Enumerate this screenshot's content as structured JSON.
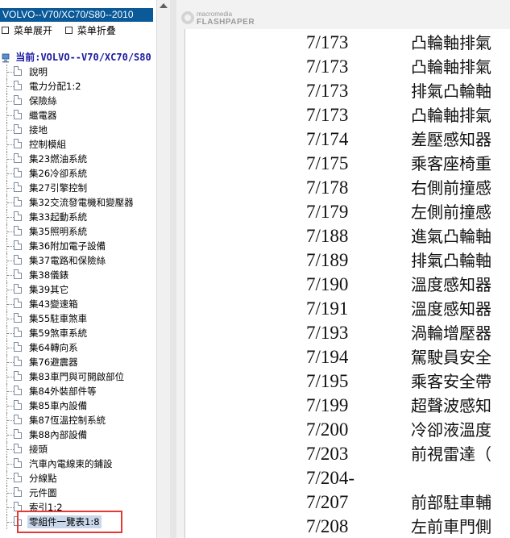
{
  "left_panel": {
    "title": "VOLVO--V70/XC70/S80--2010",
    "menu_expand": "菜单展开",
    "menu_collapse": "菜单折叠",
    "tree_root": "当前:VOLVO--V70/XC70/S80",
    "items": [
      {
        "label": "說明"
      },
      {
        "label": "電力分配1:2"
      },
      {
        "label": "保險絲"
      },
      {
        "label": "繼電器"
      },
      {
        "label": "接地"
      },
      {
        "label": "控制模組"
      },
      {
        "label": "集23燃油系統"
      },
      {
        "label": "集26冷卻系統"
      },
      {
        "label": "集27引擎控制"
      },
      {
        "label": "集32交流發電機和變壓器"
      },
      {
        "label": "集33起動系統"
      },
      {
        "label": "集35照明系統"
      },
      {
        "label": "集36附加電子設備"
      },
      {
        "label": "集37電路和保險絲"
      },
      {
        "label": "集38儀錶"
      },
      {
        "label": "集39其它"
      },
      {
        "label": "集43變速箱"
      },
      {
        "label": "集55駐車煞車"
      },
      {
        "label": "集59煞車系統"
      },
      {
        "label": "集64轉向系"
      },
      {
        "label": "集76避震器"
      },
      {
        "label": "集83車門與可開啟部位"
      },
      {
        "label": "集84外裝部件等"
      },
      {
        "label": "集85車內設備"
      },
      {
        "label": "集87恆溫控制系統"
      },
      {
        "label": "集88內部設備"
      },
      {
        "label": "接頭"
      },
      {
        "label": "汽車內電線束的鋪設"
      },
      {
        "label": "分線點"
      },
      {
        "label": "元件圖"
      },
      {
        "label": "索引1:2"
      },
      {
        "label": "零組件一覽表1:8"
      }
    ]
  },
  "viewer": {
    "logo_top": "macromedia",
    "logo_bottom": "FLASHPAPER",
    "rows": [
      {
        "num": "7/173",
        "text": "凸輪軸排氣"
      },
      {
        "num": "7/173",
        "text": "凸輪軸排氣"
      },
      {
        "num": "7/173",
        "text": "排氣凸輪軸"
      },
      {
        "num": "7/173",
        "text": "凸輪軸排氣"
      },
      {
        "num": "7/174",
        "text": "差壓感知器"
      },
      {
        "num": "7/175",
        "text": "乘客座椅重"
      },
      {
        "num": "7/178",
        "text": "右側前撞感"
      },
      {
        "num": "7/179",
        "text": "左側前撞感"
      },
      {
        "num": "7/188",
        "text": "進氣凸輪軸"
      },
      {
        "num": "7/189",
        "text": "排氣凸輪軸"
      },
      {
        "num": "7/190",
        "text": "溫度感知器"
      },
      {
        "num": "7/191",
        "text": "溫度感知器"
      },
      {
        "num": "7/193",
        "text": "渦輪增壓器"
      },
      {
        "num": "7/194",
        "text": "駕駛員安全"
      },
      {
        "num": "7/195",
        "text": "乘客安全帶"
      },
      {
        "num": "7/199",
        "text": "超聲波感知"
      },
      {
        "num": "7/200",
        "text": "冷卻液溫度"
      },
      {
        "num": "7/203",
        "text": "前視雷達（"
      },
      {
        "num": "7/204-",
        "text": ""
      },
      {
        "num": "7/207",
        "text": "前部駐車輔"
      },
      {
        "num": "7/208",
        "text": "左前車門側"
      }
    ]
  },
  "colors": {
    "title_bar": "#0a5a99",
    "tree_root_text": "#1a1aa0",
    "selection_bg": "#c9d7ea",
    "highlight_border": "#e53935"
  }
}
